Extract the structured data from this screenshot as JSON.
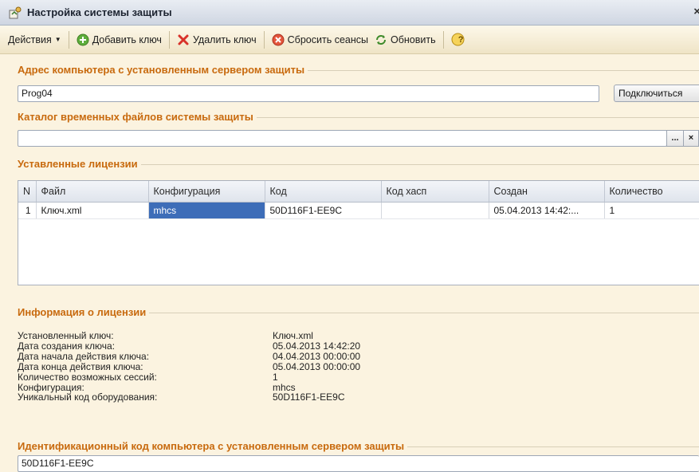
{
  "window": {
    "title": "Настройка системы защиты",
    "close": "×"
  },
  "toolbar": {
    "actions": "Действия",
    "add_key": "Добавить ключ",
    "delete_key": "Удалить ключ",
    "reset_sessions": "Сбросить сеансы",
    "refresh": "Обновить",
    "help": "?"
  },
  "server_address": {
    "label": "Адрес компьютера с установленным сервером защиты",
    "value": "Prog04",
    "connect_button": "Подключиться"
  },
  "temp_catalog": {
    "label": "Каталог временных файлов системы защиты",
    "value": "",
    "browse": "...",
    "clear": "×"
  },
  "licenses": {
    "label": "Уставленные лицензии",
    "columns": [
      "N",
      "Файл",
      "Конфигурация",
      "Код",
      "Код хасп",
      "Создан",
      "Количество"
    ],
    "rows": [
      {
        "n": "1",
        "file": "Ключ.xml",
        "config": "mhcs",
        "code": "50D116F1-EE9C",
        "hasp": "",
        "created": "05.04.2013 14:42:...",
        "count": "1"
      }
    ]
  },
  "license_info": {
    "label": "Информация о лицензии",
    "items": [
      {
        "label": "Установленный ключ:",
        "value": "Ключ.xml"
      },
      {
        "label": "Дата создания ключа:",
        "value": "05.04.2013 14:42:20"
      },
      {
        "label": "Дата начала действия ключа:",
        "value": "04.04.2013 00:00:00"
      },
      {
        "label": "Дата конца действия ключа:",
        "value": "05.04.2013 00:00:00"
      },
      {
        "label": "Количество возможных сессий:",
        "value": "1"
      },
      {
        "label": "Конфигурация:",
        "value": "mhcs"
      },
      {
        "label": "Уникальный код оборудования:",
        "value": "50D116F1-EE9C"
      }
    ]
  },
  "computer_id": {
    "label": "Идентификационный код компьютера с установленным сервером защиты",
    "value": "50D116F1-EE9C"
  }
}
